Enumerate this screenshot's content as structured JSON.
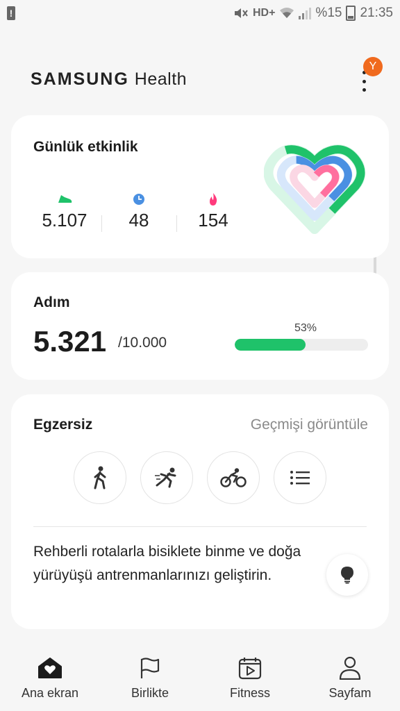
{
  "status_bar": {
    "network": "HD+",
    "battery": "%15",
    "time": "21:35"
  },
  "header": {
    "brand_part1": "SAMSUNG",
    "brand_part2": "Health",
    "avatar_letter": "Y"
  },
  "daily_activity": {
    "title": "Günlük etkinlik",
    "steps_value": "5.107",
    "minutes_value": "48",
    "calories_value": "154",
    "colors": {
      "steps": "#1fc26a",
      "minutes": "#4a90e2",
      "calories": "#ff3a7c"
    }
  },
  "steps_card": {
    "title": "Adım",
    "count": "5.321",
    "goal": "/10.000",
    "percent_label": "53%",
    "progress": 0.53
  },
  "exercise": {
    "title": "Egzersiz",
    "history_link": "Geçmişi görüntüle",
    "buttons": [
      "walking-icon",
      "running-icon",
      "cycling-icon",
      "list-icon"
    ],
    "tip": "Rehberli rotalarla bisiklete binme ve doğa yürüyüşü antrenmanlarınızı geliştirin."
  },
  "bottom_nav": {
    "items": [
      {
        "label": "Ana ekran",
        "icon": "home-heart-icon"
      },
      {
        "label": "Birlikte",
        "icon": "flag-icon"
      },
      {
        "label": "Fitness",
        "icon": "calendar-play-icon"
      },
      {
        "label": "Sayfam",
        "icon": "person-icon"
      }
    ]
  }
}
